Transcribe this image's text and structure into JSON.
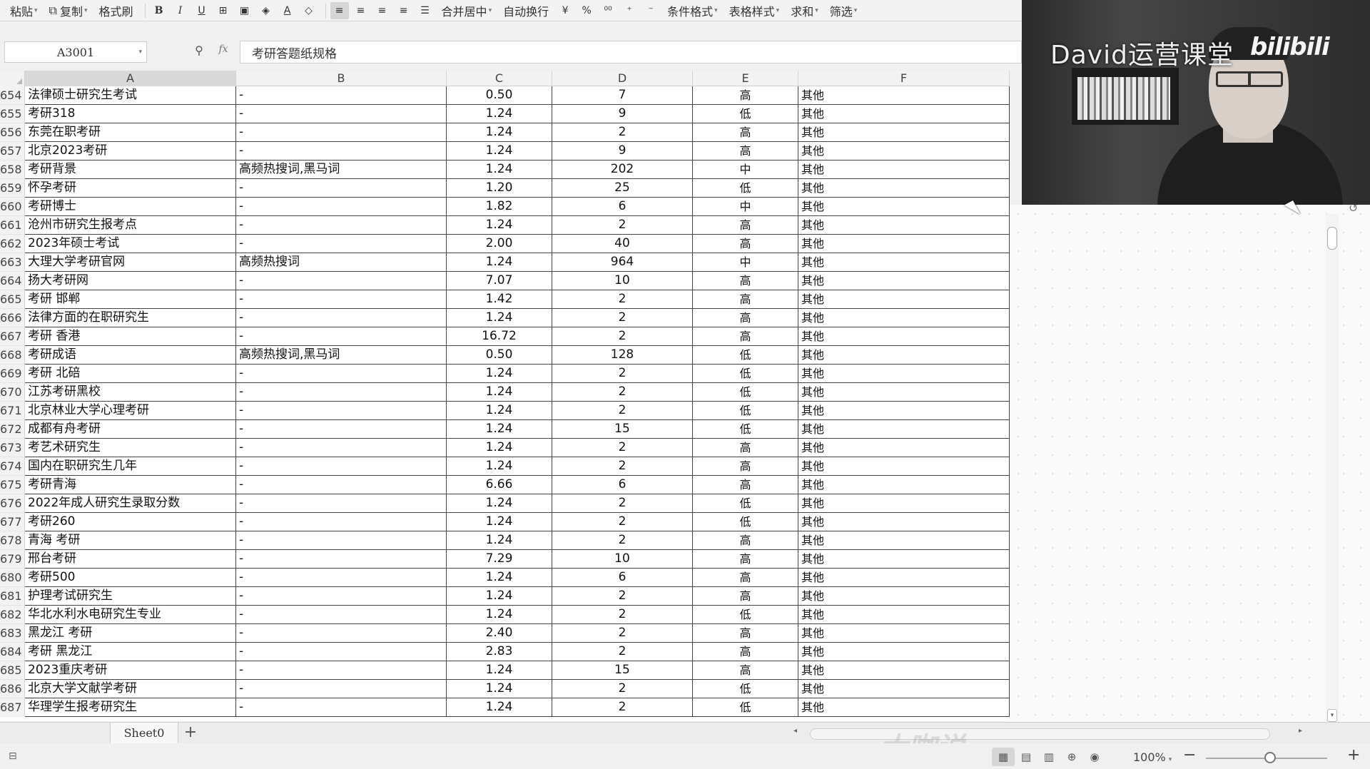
{
  "ribbon": {
    "paste": "粘贴",
    "copy": "复制",
    "format_painter": "格式刷",
    "merge_center": "合并居中",
    "wrap_text": "自动换行",
    "conditional_format": "条件格式",
    "table_style": "表格样式",
    "sum": "求和",
    "filter": "筛选",
    "percent": "%"
  },
  "formula_bar": {
    "name_box": "A3001",
    "fx": "fx",
    "content": "考研答题纸规格"
  },
  "columns": [
    "A",
    "B",
    "C",
    "D",
    "E",
    "F"
  ],
  "rows": [
    {
      "n": "654",
      "a": "法律硕士研究生考试",
      "b": "-",
      "c": "0.50",
      "d": "7",
      "e": "高",
      "f": "其他"
    },
    {
      "n": "655",
      "a": "考研318",
      "b": "-",
      "c": "1.24",
      "d": "9",
      "e": "低",
      "f": "其他"
    },
    {
      "n": "656",
      "a": "东莞在职考研",
      "b": "-",
      "c": "1.24",
      "d": "2",
      "e": "高",
      "f": "其他"
    },
    {
      "n": "657",
      "a": "北京2023考研",
      "b": "-",
      "c": "1.24",
      "d": "9",
      "e": "高",
      "f": "其他"
    },
    {
      "n": "658",
      "a": "考研背景",
      "b": "高频热搜词,黑马词",
      "c": "1.24",
      "d": "202",
      "e": "中",
      "f": "其他"
    },
    {
      "n": "659",
      "a": "怀孕考研",
      "b": "-",
      "c": "1.20",
      "d": "25",
      "e": "低",
      "f": "其他"
    },
    {
      "n": "660",
      "a": "考研博士",
      "b": "-",
      "c": "1.82",
      "d": "6",
      "e": "中",
      "f": "其他"
    },
    {
      "n": "661",
      "a": "沧州市研究生报考点",
      "b": "-",
      "c": "1.24",
      "d": "2",
      "e": "高",
      "f": "其他"
    },
    {
      "n": "662",
      "a": "2023年硕士考试",
      "b": "-",
      "c": "2.00",
      "d": "40",
      "e": "高",
      "f": "其他"
    },
    {
      "n": "663",
      "a": "大理大学考研官网",
      "b": "高频热搜词",
      "c": "1.24",
      "d": "964",
      "e": "中",
      "f": "其他"
    },
    {
      "n": "664",
      "a": "扬大考研网",
      "b": "-",
      "c": "7.07",
      "d": "10",
      "e": "高",
      "f": "其他"
    },
    {
      "n": "665",
      "a": "考研 邯郸",
      "b": "-",
      "c": "1.42",
      "d": "2",
      "e": "高",
      "f": "其他"
    },
    {
      "n": "666",
      "a": "法律方面的在职研究生",
      "b": "-",
      "c": "1.24",
      "d": "2",
      "e": "高",
      "f": "其他"
    },
    {
      "n": "667",
      "a": "考研 香港",
      "b": "-",
      "c": "16.72",
      "d": "2",
      "e": "高",
      "f": "其他"
    },
    {
      "n": "668",
      "a": "考研成语",
      "b": "高频热搜词,黑马词",
      "c": "0.50",
      "d": "128",
      "e": "低",
      "f": "其他"
    },
    {
      "n": "669",
      "a": "考研 北碚",
      "b": "-",
      "c": "1.24",
      "d": "2",
      "e": "低",
      "f": "其他"
    },
    {
      "n": "670",
      "a": "江苏考研黑校",
      "b": "-",
      "c": "1.24",
      "d": "2",
      "e": "低",
      "f": "其他"
    },
    {
      "n": "671",
      "a": "北京林业大学心理考研",
      "b": "-",
      "c": "1.24",
      "d": "2",
      "e": "低",
      "f": "其他"
    },
    {
      "n": "672",
      "a": "成都有舟考研",
      "b": "-",
      "c": "1.24",
      "d": "15",
      "e": "低",
      "f": "其他"
    },
    {
      "n": "673",
      "a": "考艺术研究生",
      "b": "-",
      "c": "1.24",
      "d": "2",
      "e": "高",
      "f": "其他"
    },
    {
      "n": "674",
      "a": "国内在职研究生几年",
      "b": "-",
      "c": "1.24",
      "d": "2",
      "e": "高",
      "f": "其他"
    },
    {
      "n": "675",
      "a": "考研青海",
      "b": "-",
      "c": "6.66",
      "d": "6",
      "e": "高",
      "f": "其他"
    },
    {
      "n": "676",
      "a": "2022年成人研究生录取分数",
      "b": "-",
      "c": "1.24",
      "d": "2",
      "e": "低",
      "f": "其他"
    },
    {
      "n": "677",
      "a": "考研260",
      "b": "-",
      "c": "1.24",
      "d": "2",
      "e": "低",
      "f": "其他"
    },
    {
      "n": "678",
      "a": "青海 考研",
      "b": "-",
      "c": "1.24",
      "d": "2",
      "e": "高",
      "f": "其他"
    },
    {
      "n": "679",
      "a": "邢台考研",
      "b": "-",
      "c": "7.29",
      "d": "10",
      "e": "高",
      "f": "其他"
    },
    {
      "n": "680",
      "a": "考研500",
      "b": "-",
      "c": "1.24",
      "d": "6",
      "e": "高",
      "f": "其他"
    },
    {
      "n": "681",
      "a": "护理考试研究生",
      "b": "-",
      "c": "1.24",
      "d": "2",
      "e": "高",
      "f": "其他"
    },
    {
      "n": "682",
      "a": "华北水利水电研究生专业",
      "b": "-",
      "c": "1.24",
      "d": "2",
      "e": "低",
      "f": "其他"
    },
    {
      "n": "683",
      "a": "黑龙江 考研",
      "b": "-",
      "c": "2.40",
      "d": "2",
      "e": "高",
      "f": "其他"
    },
    {
      "n": "684",
      "a": "考研 黑龙江",
      "b": "-",
      "c": "2.83",
      "d": "2",
      "e": "高",
      "f": "其他"
    },
    {
      "n": "685",
      "a": "2023重庆考研",
      "b": "-",
      "c": "1.24",
      "d": "15",
      "e": "高",
      "f": "其他"
    },
    {
      "n": "686",
      "a": "北京大学文献学考研",
      "b": "-",
      "c": "1.24",
      "d": "2",
      "e": "低",
      "f": "其他"
    },
    {
      "n": "687",
      "a": "华理学生报考研究生",
      "b": "-",
      "c": "1.24",
      "d": "2",
      "e": "低",
      "f": "其他"
    }
  ],
  "sheet_tab": "Sheet0",
  "status": {
    "zoom": "100%"
  },
  "webcam": {
    "title": "David运营课堂",
    "logo": "bilibili"
  },
  "watermark": "大咖说"
}
